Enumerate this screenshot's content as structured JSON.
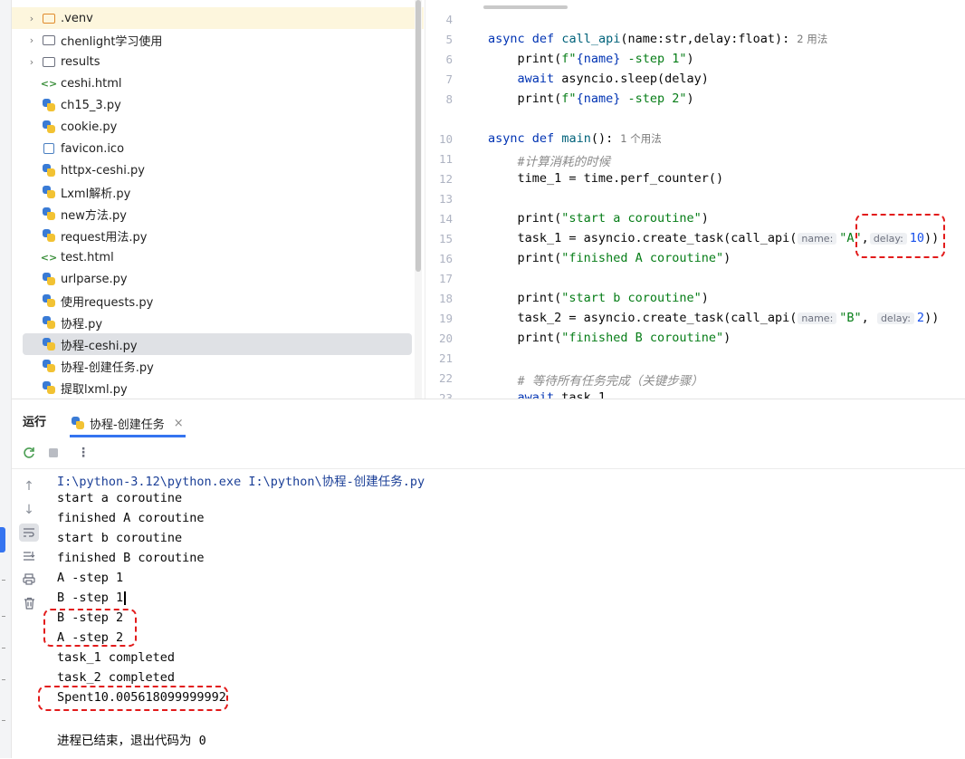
{
  "project_tree": {
    "items": [
      {
        "label": ".venv",
        "type": "folder-orange",
        "expandable": true
      },
      {
        "label": "chenlight学习使用",
        "type": "folder",
        "expandable": true
      },
      {
        "label": "results",
        "type": "folder",
        "expandable": true
      },
      {
        "label": "ceshi.html",
        "type": "html"
      },
      {
        "label": "ch15_3.py",
        "type": "python"
      },
      {
        "label": "cookie.py",
        "type": "python"
      },
      {
        "label": "favicon.ico",
        "type": "image"
      },
      {
        "label": "httpx-ceshi.py",
        "type": "python"
      },
      {
        "label": "Lxml解析.py",
        "type": "python"
      },
      {
        "label": "new方法.py",
        "type": "python"
      },
      {
        "label": "request用法.py",
        "type": "python"
      },
      {
        "label": "test.html",
        "type": "html"
      },
      {
        "label": "urlparse.py",
        "type": "python"
      },
      {
        "label": "使用requests.py",
        "type": "python"
      },
      {
        "label": "协程.py",
        "type": "python"
      },
      {
        "label": "协程-ceshi.py",
        "type": "python",
        "selected": true
      },
      {
        "label": "协程-创建任务.py",
        "type": "python"
      },
      {
        "label": "提取lxml.py",
        "type": "python"
      }
    ]
  },
  "editor": {
    "line_numbers": [
      "4",
      "5",
      "6",
      "7",
      "8",
      "10",
      "11",
      "12",
      "13",
      "14",
      "15",
      "16",
      "17",
      "18",
      "19",
      "20",
      "21",
      "22",
      "23"
    ],
    "usage_hints": {
      "call_api": "2 用法",
      "main": "1 个用法"
    },
    "param_hints": {
      "name": "name:",
      "delay": "delay:"
    },
    "code": {
      "l5_a": "async",
      "l5_b": "def",
      "l5_c": "call_api",
      "l5_d": "(name:str,delay:float):",
      "l6_a": "print(",
      "l6_b": "f\"",
      "l6_c": "{name}",
      "l6_d": " -step 1\"",
      "l6_e": ")",
      "l7_a": "await",
      "l7_b": " asyncio.sleep(delay)",
      "l8_a": "print(",
      "l8_b": "f\"",
      "l8_c": "{name}",
      "l8_d": " -step 2\"",
      "l8_e": ")",
      "l10_a": "async",
      "l10_b": "def",
      "l10_c": "main",
      "l10_d": "():",
      "l11": "#计算消耗的时候",
      "l12": "time_1 = time.perf_counter()",
      "l14_a": "print(",
      "l14_b": "\"start a coroutine\"",
      "l14_c": ")",
      "l15_a": "task_1 = asyncio.create_task(call_api(",
      "l15_b": "\"A\"",
      "l15_c": ",",
      "l15_d": "10",
      "l15_e": "))",
      "l16_a": "print(",
      "l16_b": "\"finished A coroutine\"",
      "l16_c": ")",
      "l18_a": "print(",
      "l18_b": "\"start b coroutine\"",
      "l18_c": ")",
      "l19_a": "task_2 = asyncio.create_task(call_api(",
      "l19_b": "\"B\"",
      "l19_c": ",",
      "l19_d": "2",
      "l19_e": "))",
      "l20_a": "print(",
      "l20_b": "\"finished B coroutine\"",
      "l20_c": ")",
      "l22": "# 等待所有任务完成（关键步骤）",
      "l23_a": "await",
      "l23_b": " task_1"
    }
  },
  "run_panel": {
    "title": "运行",
    "tab_label": "协程-创建任务",
    "close_glyph": "×",
    "console_lines": [
      "I:\\python-3.12\\python.exe I:\\python\\协程-创建任务.py",
      "start a coroutine",
      "finished A coroutine",
      "start b coroutine",
      "finished B coroutine",
      "A -step 1",
      "B -step 1",
      "B -step 2",
      "A -step 2",
      "task_1 completed",
      "task_2 completed",
      "Spent10.005618099999992",
      "进程已结束，退出代码为 0"
    ]
  },
  "colors": {
    "accent": "#3574f0",
    "annotation_red": "#e21b1b",
    "keyword": "#0033b3",
    "string": "#067d17",
    "number": "#1750eb",
    "function": "#00627a"
  },
  "icons": [
    "folder-icon",
    "python-file-icon",
    "html-file-icon",
    "image-file-icon",
    "rerun-icon",
    "stop-icon",
    "more-icon",
    "arrow-up-icon",
    "arrow-down-icon",
    "soft-wrap-icon",
    "scroll-to-end-icon",
    "print-icon",
    "trash-icon",
    "close-icon",
    "chevron-right-icon"
  ]
}
